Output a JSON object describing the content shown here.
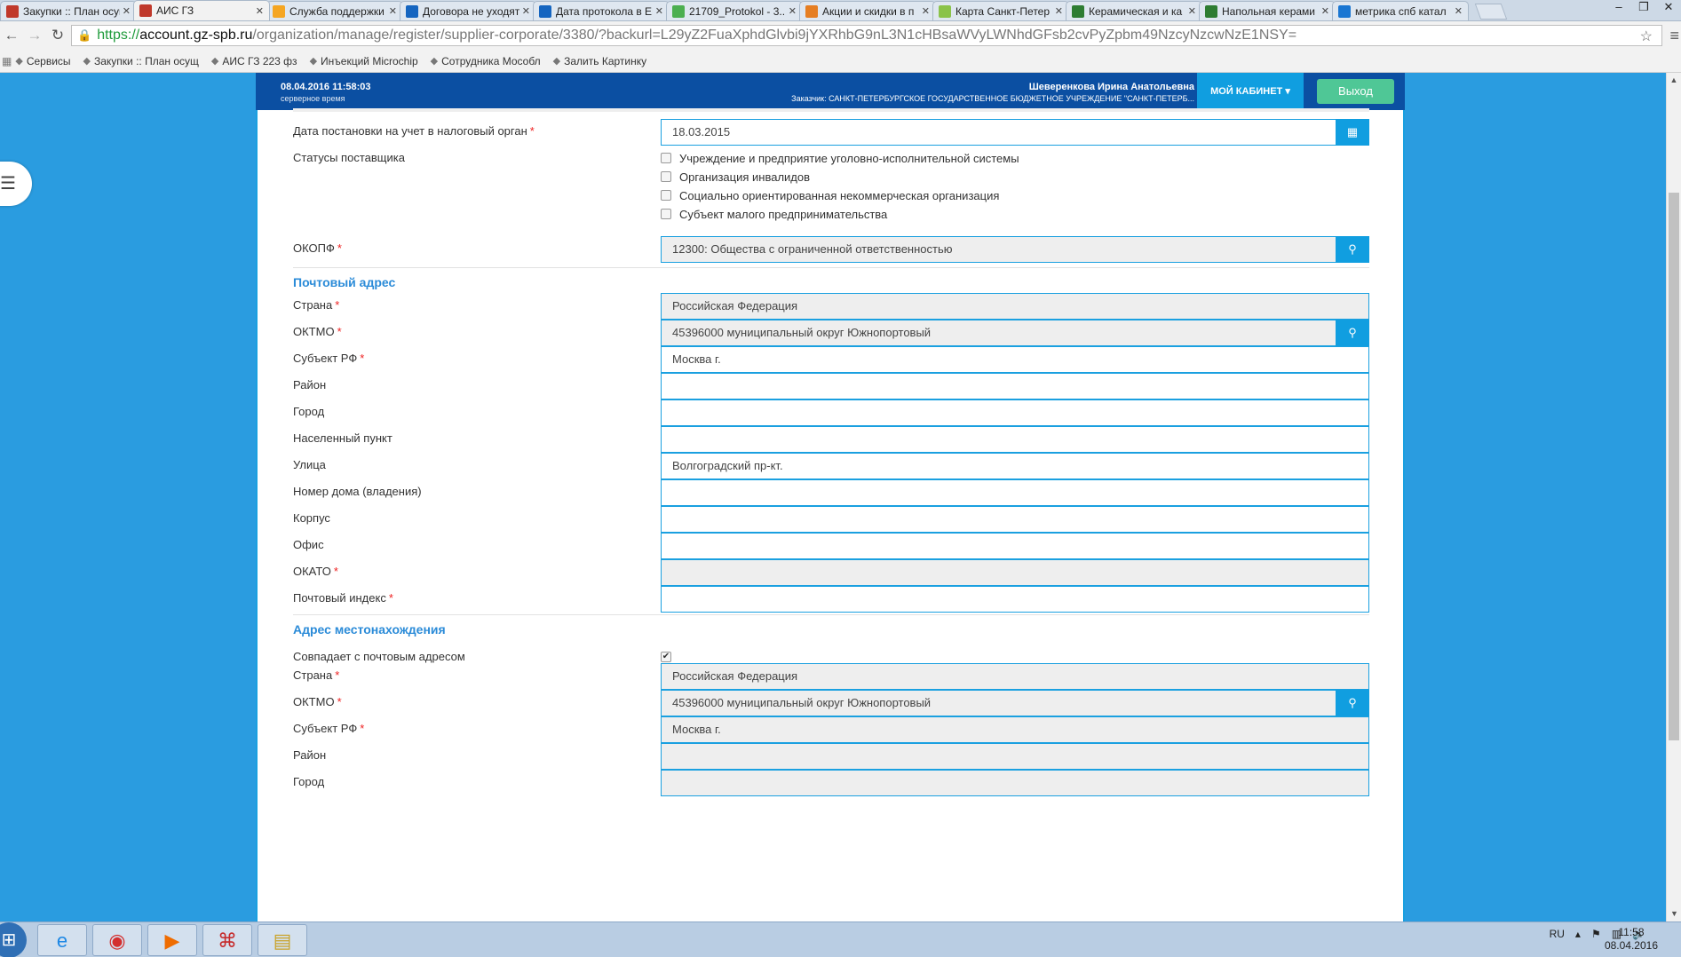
{
  "browser": {
    "tabs": [
      {
        "label": "Закупки :: План осущ",
        "color": "#c0392b",
        "icon": "hammer-icon"
      },
      {
        "label": "АИС ГЗ",
        "color": "#c0392b",
        "icon": "hammer-icon",
        "active": true
      },
      {
        "label": "Служба поддержки",
        "color": "#f5a623",
        "icon": "support-icon"
      },
      {
        "label": "Договора не уходят",
        "color": "#1565c0",
        "icon": "question-icon"
      },
      {
        "label": "Дата протокола в ЕИ",
        "color": "#1565c0",
        "icon": "question-icon"
      },
      {
        "label": "21709_Protokol - 3...",
        "color": "#4caf50",
        "icon": "file-icon"
      },
      {
        "label": "Акции и скидки в п",
        "color": "#e67e22",
        "icon": "tag-icon"
      },
      {
        "label": "Карта Санкт-Петер",
        "color": "#8bc34a",
        "icon": "map-icon"
      },
      {
        "label": "Керамическая и ка",
        "color": "#2e7d32",
        "icon": "house-icon"
      },
      {
        "label": "Напольная керами",
        "color": "#2e7d32",
        "icon": "house-icon"
      },
      {
        "label": "метрика спб катал",
        "color": "#1976d2",
        "icon": "search-icon"
      }
    ],
    "tab_close": "✕",
    "window_controls": {
      "minimize": "–",
      "maximize": "❐",
      "close": "✕"
    },
    "url": {
      "scheme": "https://",
      "host": "account.gz-spb.ru",
      "path": "/organization/manage/register/supplier-corporate/3380/?backurl=L29yZ2FuaXphdGlvbi9jYXRhbG9nL3N1cHBsaWVyLWNhdGFsb2cvPyZpbm49NzcyNzcwNzE1NSY="
    },
    "bookmarks": [
      {
        "label": "Сервисы"
      },
      {
        "label": "Закупки :: План осущ"
      },
      {
        "label": "АИС ГЗ 223 фз"
      },
      {
        "label": "Инъекций Microchip"
      },
      {
        "label": "Сотрудника Мособл"
      },
      {
        "label": "Залить Картинку"
      }
    ]
  },
  "header": {
    "datetime": "08.04.2016 11:58:03",
    "datetime_sub": "серверное время",
    "user_name": "Шеверенкова Ирина Анатольевна",
    "customer": "Заказчик: САНКТ-ПЕТЕРБУРГСКОЕ ГОСУДАРСТВЕННОЕ БЮДЖЕТНОЕ УЧРЕЖДЕНИЕ \"САНКТ-ПЕТЕРБ...",
    "cabinet_label": "МОЙ КАБИНЕТ",
    "logout_label": "Выход"
  },
  "form": {
    "tax_date": {
      "label": "Дата постановки на учет в налоговый орган",
      "value": "18.03.2015"
    },
    "statuses": {
      "label": "Статусы поставщика",
      "options": [
        "Учреждение и предприятие уголовно-исполнительной системы",
        "Организация инвалидов",
        "Социально ориентированная некоммерческая организация",
        "Субъект малого предпринимательства"
      ]
    },
    "okopf": {
      "label": "ОКОПФ",
      "value": "12300: Общества с ограниченной ответственностью"
    },
    "postal": {
      "title": "Почтовый адрес",
      "country": {
        "label": "Страна",
        "value": "Российская Федерация"
      },
      "oktmo": {
        "label": "ОКТМО",
        "value": "45396000 муниципальный округ Южнопортовый"
      },
      "subject": {
        "label": "Субъект РФ",
        "value": "Москва г."
      },
      "district": {
        "label": "Район",
        "value": ""
      },
      "city": {
        "label": "Город",
        "value": ""
      },
      "locality": {
        "label": "Населенный пункт",
        "value": ""
      },
      "street": {
        "label": "Улица",
        "value": "Волгоградский пр-кт."
      },
      "house": {
        "label": "Номер дома (владения)",
        "value": ""
      },
      "building": {
        "label": "Корпус",
        "value": ""
      },
      "office": {
        "label": "Офис",
        "value": ""
      },
      "okato": {
        "label": "ОКАТО",
        "value": ""
      },
      "index": {
        "label": "Почтовый индекс",
        "value": ""
      }
    },
    "location": {
      "title": "Адрес местонахождения",
      "same_as_postal": {
        "label": "Совпадает с почтовым адресом",
        "checked": true
      },
      "country": {
        "label": "Страна",
        "value": "Российская Федерация"
      },
      "oktmo": {
        "label": "ОКТМО",
        "value": "45396000 муниципальный округ Южнопортовый"
      },
      "subject": {
        "label": "Субъект РФ",
        "value": "Москва г."
      },
      "district": {
        "label": "Район",
        "value": ""
      },
      "city": {
        "label": "Город",
        "value": ""
      }
    },
    "required_mark": "*"
  },
  "taskbar": {
    "lang": "RU",
    "time": "11:58",
    "date": "08.04.2016"
  },
  "colors": {
    "page_bg": "#2a9ce0",
    "header_bg": "#0b4fa2",
    "accent": "#109ee0",
    "logout": "#4fc796",
    "section_title": "#2b8bd8",
    "required": "#e22222"
  }
}
